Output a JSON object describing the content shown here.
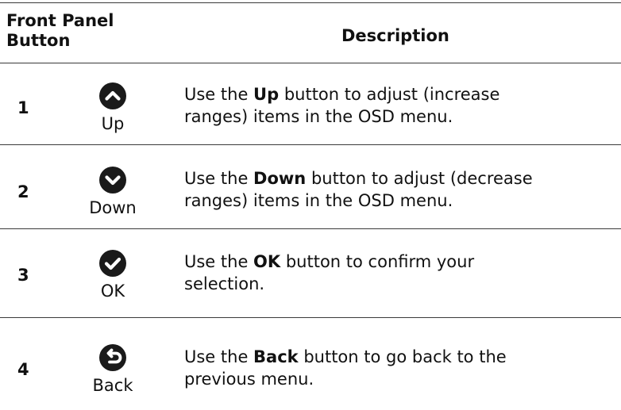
{
  "header": {
    "col1_line1": "Front Panel",
    "col1_line2": "Button",
    "col2": "Description"
  },
  "rows": [
    {
      "number": "1",
      "icon": "chevron-up-circle-icon",
      "label": "Up",
      "desc_prefix": "Use the ",
      "desc_bold": "Up",
      "desc_line1_rest": " button to adjust (increase",
      "desc_line2": "ranges) items in the OSD menu."
    },
    {
      "number": "2",
      "icon": "chevron-down-circle-icon",
      "label": "Down",
      "desc_prefix": "Use the ",
      "desc_bold": "Down",
      "desc_line1_rest": " button to adjust (decrease",
      "desc_line2": "ranges) items in the OSD menu."
    },
    {
      "number": "3",
      "icon": "check-circle-icon",
      "label": "OK",
      "desc_prefix": "Use the ",
      "desc_bold": "OK",
      "desc_line1_rest": " button to confirm your",
      "desc_line2": "selection."
    },
    {
      "number": "4",
      "icon": "back-arrow-circle-icon",
      "label": "Back",
      "desc_prefix": "Use the ",
      "desc_bold": "Back",
      "desc_line1_rest": " button to go back to the",
      "desc_line2": "previous menu."
    }
  ]
}
